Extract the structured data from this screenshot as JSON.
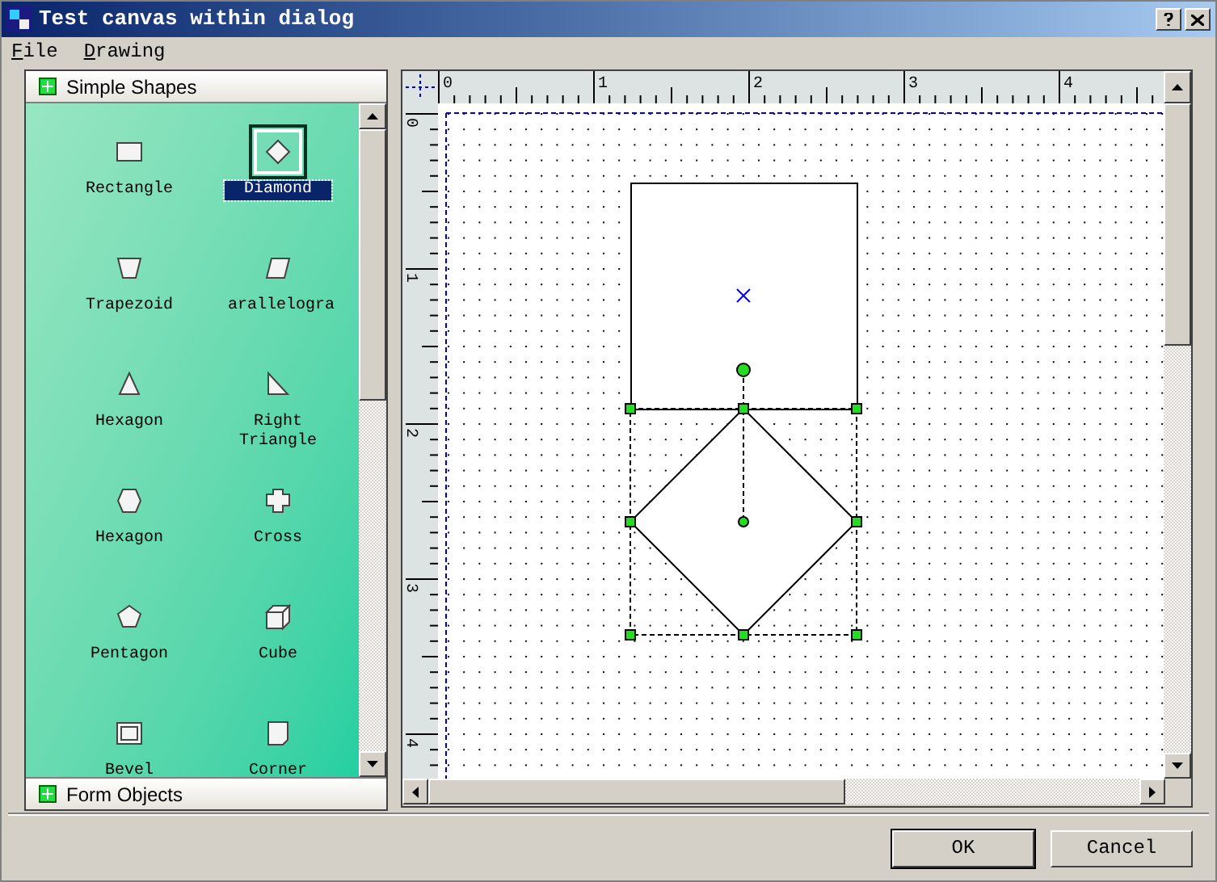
{
  "window": {
    "title": "Test canvas within dialog"
  },
  "menu": [
    "File",
    "Drawing"
  ],
  "palette": {
    "open_group": "Simple Shapes",
    "closed_group": "Form Objects",
    "shapes": [
      {
        "kind": "rectangle",
        "label": "Rectangle",
        "selected": false
      },
      {
        "kind": "diamond",
        "label": "Diamond",
        "selected": true
      },
      {
        "kind": "trapezoid",
        "label": "Trapezoid",
        "selected": false
      },
      {
        "kind": "parallelogram",
        "label": "arallelogra",
        "selected": false
      },
      {
        "kind": "triangle",
        "label": "Hexagon",
        "selected": false
      },
      {
        "kind": "right-triangle",
        "label": "Right Triangle",
        "selected": false
      },
      {
        "kind": "hexagon",
        "label": "Hexagon",
        "selected": false
      },
      {
        "kind": "cross",
        "label": "Cross",
        "selected": false
      },
      {
        "kind": "pentagon",
        "label": "Pentagon",
        "selected": false
      },
      {
        "kind": "cube",
        "label": "Cube",
        "selected": false
      },
      {
        "kind": "bevel",
        "label": "Bevel",
        "selected": false
      },
      {
        "kind": "corner",
        "label": "Corner",
        "selected": false
      }
    ]
  },
  "rulers": {
    "horizontal": [
      "0",
      "1",
      "2",
      "3",
      "4"
    ],
    "vertical": [
      "0",
      "1",
      "2",
      "3",
      "4"
    ]
  },
  "canvas": {
    "objects": [
      {
        "kind": "rectangle",
        "selected": false
      },
      {
        "kind": "diamond",
        "selected": true
      }
    ]
  },
  "buttons": [
    {
      "label": "OK",
      "default": true
    },
    {
      "label": "Cancel",
      "default": false
    }
  ]
}
